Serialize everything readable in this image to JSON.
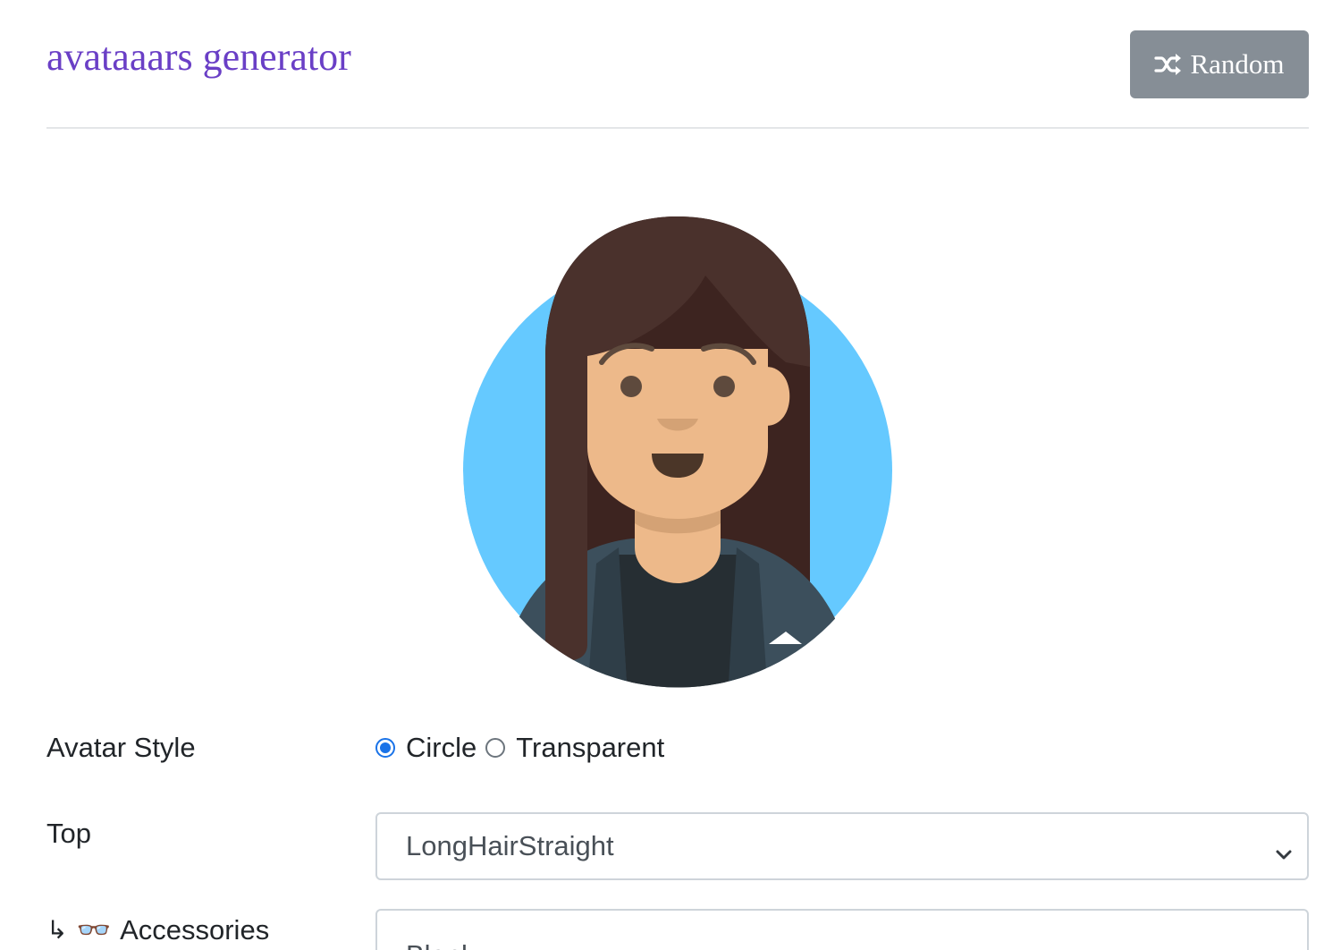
{
  "header": {
    "title": "avataaars generator",
    "random_label": "Random"
  },
  "avatar": {
    "background_color": "#65c9ff",
    "skin_color": "#edb98a",
    "hair_color": "#4a312c",
    "clothing_color": "#3c4f5c",
    "shirt_color": "#262e33"
  },
  "form": {
    "avatar_style": {
      "label": "Avatar Style",
      "options": [
        {
          "label": "Circle",
          "selected": true
        },
        {
          "label": "Transparent",
          "selected": false
        }
      ]
    },
    "top": {
      "label": "Top",
      "value": "LongHairStraight"
    },
    "accessories": {
      "prefix": "↳",
      "emoji": "👓",
      "label": "Accessories",
      "value": "Blank"
    }
  }
}
